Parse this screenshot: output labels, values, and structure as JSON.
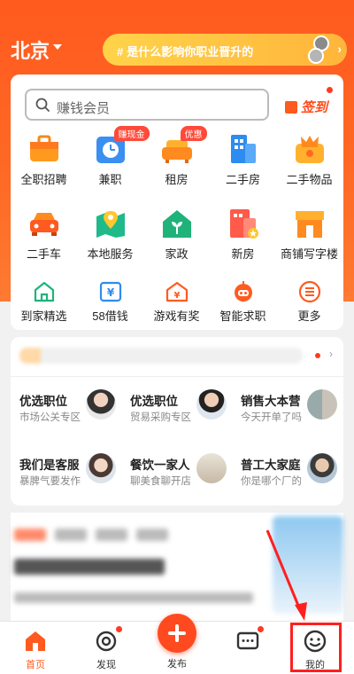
{
  "header": {
    "city": "北京",
    "banner_text": "是什么影响你职业晋升的"
  },
  "search": {
    "placeholder": "赚钱会员",
    "checkin_label": "签到"
  },
  "categories_row1": [
    {
      "label": "全职招聘",
      "icon": "briefcase-icon",
      "badge": ""
    },
    {
      "label": "兼职",
      "icon": "clock-icon",
      "badge": "赚现金"
    },
    {
      "label": "租房",
      "icon": "sofa-icon",
      "badge": "优惠"
    },
    {
      "label": "二手房",
      "icon": "building-icon",
      "badge": ""
    },
    {
      "label": "二手物品",
      "icon": "crown-icon",
      "badge": ""
    }
  ],
  "categories_row2": [
    {
      "label": "二手车",
      "icon": "car-icon"
    },
    {
      "label": "本地服务",
      "icon": "map-pin-icon"
    },
    {
      "label": "家政",
      "icon": "house-leaf-icon"
    },
    {
      "label": "新房",
      "icon": "new-house-icon"
    },
    {
      "label": "商铺写字楼",
      "icon": "shop-icon"
    }
  ],
  "categories_row3": [
    {
      "label": "到家精选",
      "icon": "home-outline-icon"
    },
    {
      "label": "58借钱",
      "icon": "yen-card-icon"
    },
    {
      "label": "游戏有奖",
      "icon": "yen-house-icon"
    },
    {
      "label": "智能求职",
      "icon": "robot-icon"
    },
    {
      "label": "更多",
      "icon": "menu-circle-icon"
    }
  ],
  "jobs": [
    {
      "title": "优选职位",
      "sub": "市场公关专区"
    },
    {
      "title": "优选职位",
      "sub": "贸易采购专区"
    },
    {
      "title": "销售大本营",
      "sub": "今天开单了吗"
    },
    {
      "title": "我们是客服",
      "sub": "暴脾气要发作"
    },
    {
      "title": "餐饮一家人",
      "sub": "聊美食聊开店"
    },
    {
      "title": "普工大家庭",
      "sub": "你是哪个厂的"
    }
  ],
  "bottom_nav": [
    {
      "label": "首页",
      "icon": "home-icon",
      "active": true
    },
    {
      "label": "发现",
      "icon": "discover-icon",
      "active": false
    },
    {
      "label": "发布",
      "icon": "plus-icon",
      "active": false
    },
    {
      "label": "消息",
      "icon": "message-icon",
      "active": false
    },
    {
      "label": "我的",
      "icon": "smile-icon",
      "active": false
    }
  ],
  "colors": {
    "brand": "#ff5a1f",
    "highlight": "#ff1f1f"
  }
}
